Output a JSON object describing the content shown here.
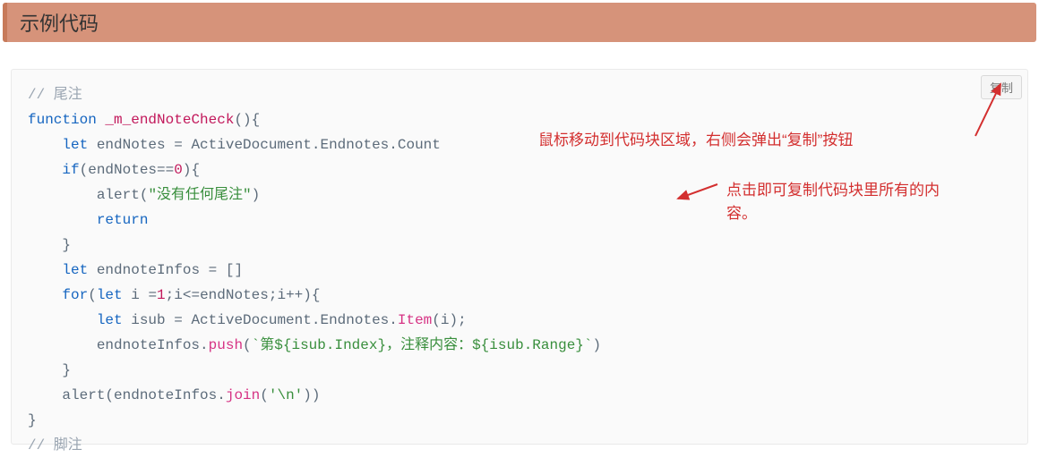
{
  "header": {
    "title": "示例代码"
  },
  "copy_button": {
    "label": "复制"
  },
  "code": {
    "lines": [
      {
        "indent": 0,
        "tokens": [
          {
            "t": "// 尾注",
            "c": "c-comment"
          }
        ]
      },
      {
        "indent": 0,
        "tokens": [
          {
            "t": "function",
            "c": "c-keyword"
          },
          {
            "t": " ",
            "c": ""
          },
          {
            "t": "_m_endNoteCheck",
            "c": "c-fn"
          },
          {
            "t": "(){",
            "c": "c-punct"
          }
        ]
      },
      {
        "indent": 1,
        "tokens": [
          {
            "t": "let",
            "c": "c-keyword"
          },
          {
            "t": " endNotes = ActiveDocument.Endnotes.Count",
            "c": "c-ident"
          }
        ]
      },
      {
        "indent": 1,
        "tokens": [
          {
            "t": "if",
            "c": "c-keyword"
          },
          {
            "t": "(endNotes==",
            "c": "c-ident"
          },
          {
            "t": "0",
            "c": "c-num"
          },
          {
            "t": "){",
            "c": "c-punct"
          }
        ]
      },
      {
        "indent": 2,
        "tokens": [
          {
            "t": "alert",
            "c": "c-ident"
          },
          {
            "t": "(",
            "c": "c-punct"
          },
          {
            "t": "\"没有任何尾注\"",
            "c": "c-string"
          },
          {
            "t": ")",
            "c": "c-punct"
          }
        ]
      },
      {
        "indent": 2,
        "tokens": [
          {
            "t": "return",
            "c": "c-keyword"
          }
        ]
      },
      {
        "indent": 1,
        "tokens": [
          {
            "t": "}",
            "c": "c-punct"
          }
        ]
      },
      {
        "indent": 1,
        "tokens": [
          {
            "t": "let",
            "c": "c-keyword"
          },
          {
            "t": " endnoteInfos = []",
            "c": "c-ident"
          }
        ]
      },
      {
        "indent": 1,
        "tokens": [
          {
            "t": "for",
            "c": "c-keyword"
          },
          {
            "t": "(",
            "c": "c-punct"
          },
          {
            "t": "let",
            "c": "c-keyword"
          },
          {
            "t": " i =",
            "c": "c-ident"
          },
          {
            "t": "1",
            "c": "c-num"
          },
          {
            "t": ";i<=endNotes;i++){",
            "c": "c-ident"
          }
        ]
      },
      {
        "indent": 2,
        "tokens": [
          {
            "t": "let",
            "c": "c-keyword"
          },
          {
            "t": " isub = ActiveDocument.Endnotes.",
            "c": "c-ident"
          },
          {
            "t": "Item",
            "c": "c-method"
          },
          {
            "t": "(i);",
            "c": "c-ident"
          }
        ]
      },
      {
        "indent": 2,
        "tokens": [
          {
            "t": "endnoteInfos.",
            "c": "c-ident"
          },
          {
            "t": "push",
            "c": "c-method"
          },
          {
            "t": "(",
            "c": "c-punct"
          },
          {
            "t": "`第${isub.Index}，注释内容：${isub.Range}`",
            "c": "c-string"
          },
          {
            "t": ")",
            "c": "c-punct"
          }
        ]
      },
      {
        "indent": 1,
        "tokens": [
          {
            "t": "}",
            "c": "c-punct"
          }
        ]
      },
      {
        "indent": 1,
        "tokens": [
          {
            "t": "alert",
            "c": "c-ident"
          },
          {
            "t": "(endnoteInfos.",
            "c": "c-ident"
          },
          {
            "t": "join",
            "c": "c-method"
          },
          {
            "t": "(",
            "c": "c-punct"
          },
          {
            "t": "'\\n'",
            "c": "c-string"
          },
          {
            "t": "))",
            "c": "c-punct"
          }
        ]
      },
      {
        "indent": 0,
        "tokens": [
          {
            "t": "}",
            "c": "c-punct"
          }
        ]
      },
      {
        "indent": 0,
        "tokens": [
          {
            "t": "// 脚注",
            "c": "c-comment"
          }
        ]
      }
    ]
  },
  "annotations": {
    "note1": "鼠标移动到代码块区域，右侧会弹出“复制”按钮",
    "note2": "点击即可复制代码块里所有的内容。"
  }
}
